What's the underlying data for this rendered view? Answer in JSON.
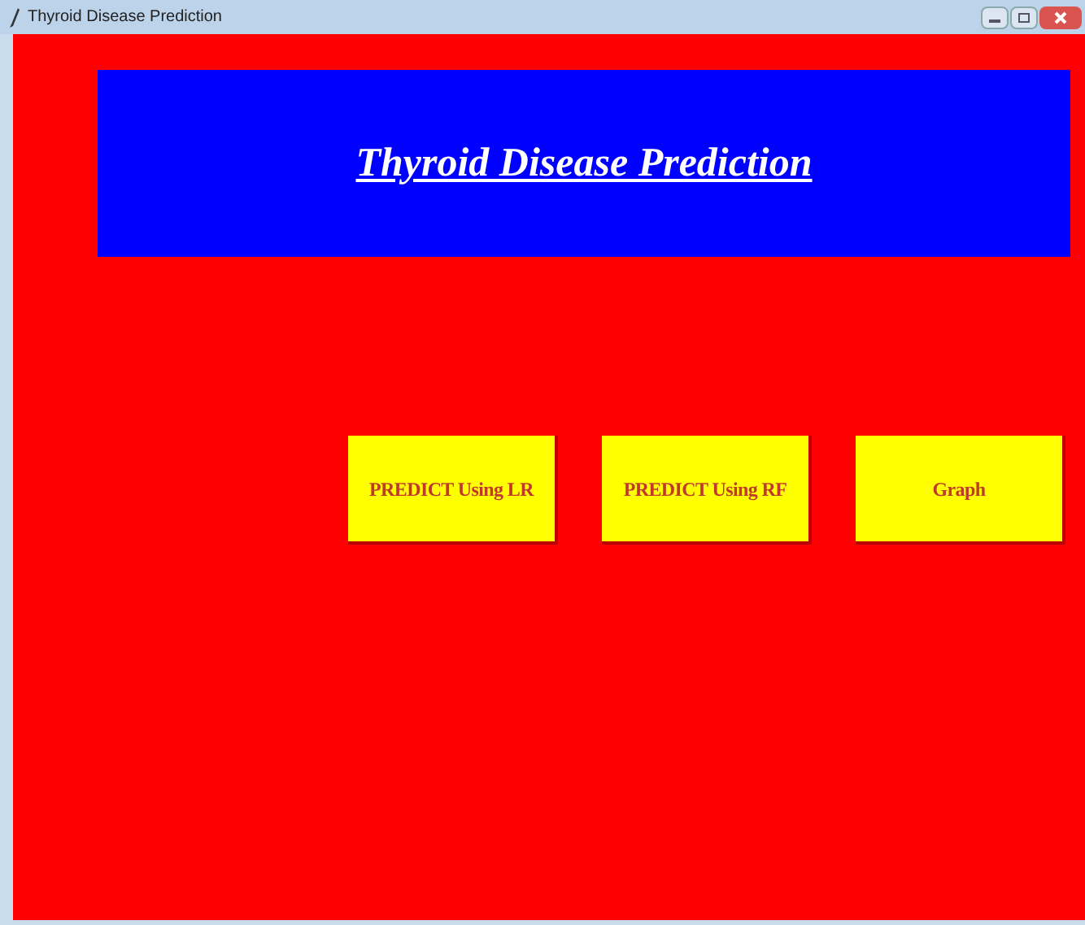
{
  "window": {
    "title": "Thyroid Disease Prediction"
  },
  "banner": {
    "title": "Thyroid Disease Prediction"
  },
  "buttons": [
    {
      "label": "PREDICT Using LR"
    },
    {
      "label": "PREDICT Using RF"
    },
    {
      "label": "Graph"
    }
  ]
}
